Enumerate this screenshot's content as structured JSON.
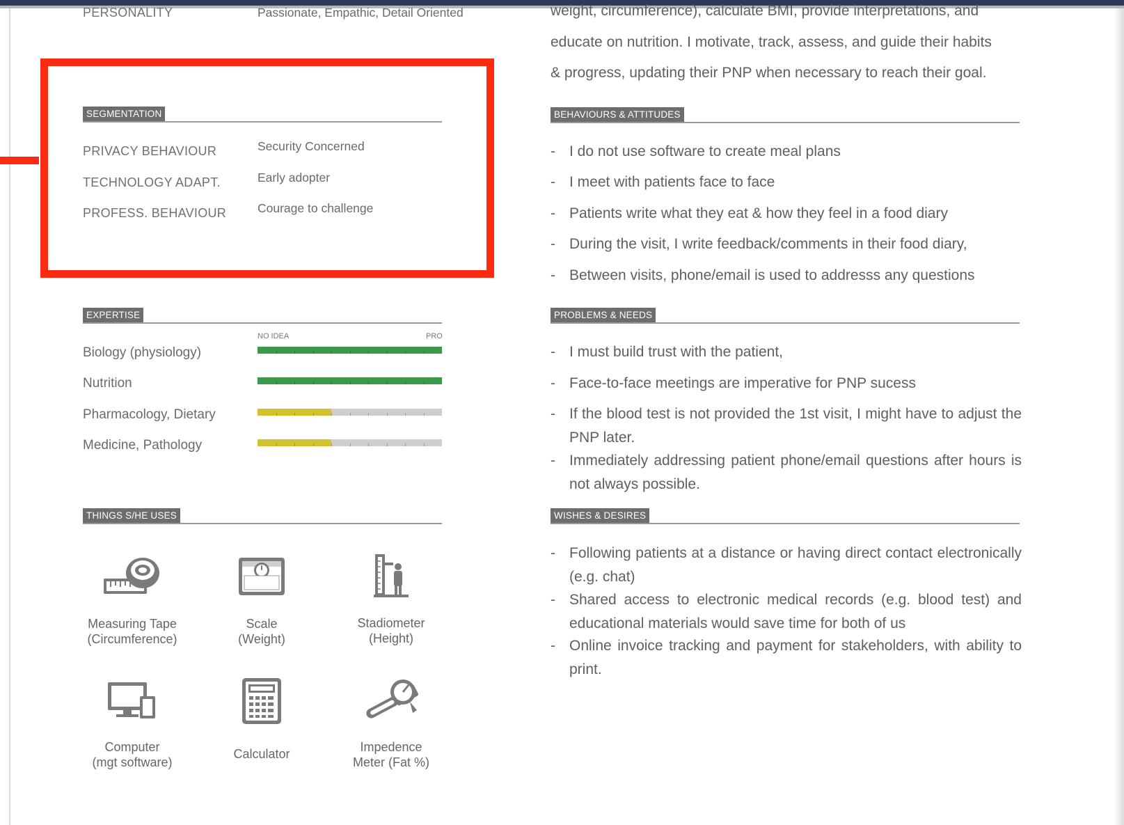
{
  "personality": {
    "label": "PERSONALITY",
    "value": "Passionate, Empathic, Detail Oriented"
  },
  "intro_lines": [
    "weight, circumference), calculate BMI, provide interpretations, and",
    "educate on nutrition. I motivate, track, assess, and guide their habits",
    "& progress, updating their PNP when necessary to reach their goal."
  ],
  "segmentation": {
    "title": "SEGMENTATION",
    "rows": [
      {
        "label": "PRIVACY BEHAVIOUR",
        "value": "Security Concerned"
      },
      {
        "label": "TECHNOLOGY ADAPT.",
        "value": "Early adopter"
      },
      {
        "label": "PROFESS. BEHAVIOUR",
        "value": "Courage to challenge"
      }
    ]
  },
  "expertise": {
    "title": "EXPERTISE",
    "scale_min": "NO IDEA",
    "scale_max": "PRO",
    "items": [
      {
        "label": "Biology (physiology)",
        "level": 1.0,
        "color": "#3a9a4a"
      },
      {
        "label": "Nutrition",
        "level": 1.0,
        "color": "#3a9a4a"
      },
      {
        "label": "Pharmacology, Dietary",
        "level": 0.4,
        "color": "#d3c22e"
      },
      {
        "label": "Medicine, Pathology",
        "level": 0.4,
        "color": "#d3c22e"
      }
    ]
  },
  "things_used": {
    "title": "THINGS S/HE USES",
    "items": [
      {
        "icon": "measuring-tape-icon",
        "label": "Measuring Tape\n(Circumference)"
      },
      {
        "icon": "scale-icon",
        "label": "Scale\n(Weight)"
      },
      {
        "icon": "stadiometer-icon",
        "label": "Stadiometer\n(Height)"
      },
      {
        "icon": "computer-icon",
        "label": "Computer\n(mgt software)"
      },
      {
        "icon": "calculator-icon",
        "label": "Calculator"
      },
      {
        "icon": "impedence-meter-icon",
        "label": "Impedence\nMeter (Fat %)"
      }
    ]
  },
  "behaviours": {
    "title": "BEHAVIOURS & ATTITUDES",
    "items": [
      "I do not use software to create meal plans",
      "I meet with patients face to face",
      "Patients write what they eat & how they feel in a food diary",
      "During the visit, I write feedback/comments in their food diary,",
      "Between visits, phone/email is used to addresss any questions"
    ]
  },
  "problems": {
    "title": "PROBLEMS & NEEDS",
    "items": [
      "I must build trust with the patient,",
      "Face-to-face meetings are imperative for PNP sucess",
      "If the blood test is not provided the 1st visit, I might have to adjust the PNP later.",
      "Immediately addressing patient phone/email questions after hours is not always possible."
    ]
  },
  "wishes": {
    "title": "WISHES & DESIRES",
    "items": [
      "Following patients at a distance or having direct contact electronically (e.g. chat)",
      "Shared access to electronic medical records (e.g. blood test) and educational materials would save time for both of us",
      "Online invoice tracking and payment for stakeholders, with ability to print."
    ]
  },
  "bullet_dash": "-",
  "highlight_color": "#ff2a12"
}
